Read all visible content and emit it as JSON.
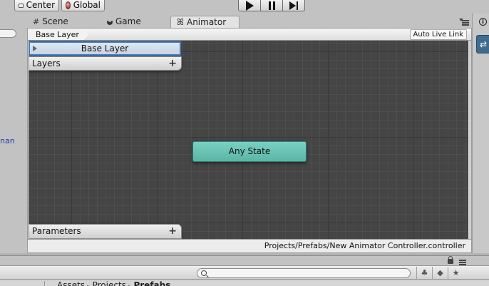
{
  "toolbar": {
    "pivot_label": "Center",
    "pivot_icon": "center-icon",
    "space_label": "Global",
    "space_icon": "globe-icon",
    "playback": [
      "play-icon",
      "pause-icon",
      "step-icon"
    ]
  },
  "tabs": [
    {
      "label": "Scene",
      "icon": "hash-icon"
    },
    {
      "label": "Game",
      "icon": "pacman-icon"
    },
    {
      "label": "Animator",
      "icon": "animator-icon",
      "active": true
    }
  ],
  "left_panel": {
    "link_text": "nan"
  },
  "animator": {
    "breadcrumb": "Base Layer",
    "live_link_label": "Auto Live Link",
    "layers": {
      "selected_layer": "Base Layer",
      "header": "Layers",
      "add_icon": "plus-icon"
    },
    "parameters": {
      "header": "Parameters",
      "add_icon": "plus-icon"
    },
    "states": [
      {
        "name": "Any State",
        "color": "#6cc4b4"
      }
    ],
    "status_path": "Projects/Prefabs/New Animator Controller.controller"
  },
  "colors": {
    "graph_bg": "#454545",
    "selection_border": "#3f7cc4",
    "any_state": "#6cc4b4",
    "link": "#1f3fb0"
  },
  "project": {
    "search_placeholder": "",
    "breadcrumbs": [
      "Assets",
      "Projects",
      "Prefabs"
    ]
  }
}
